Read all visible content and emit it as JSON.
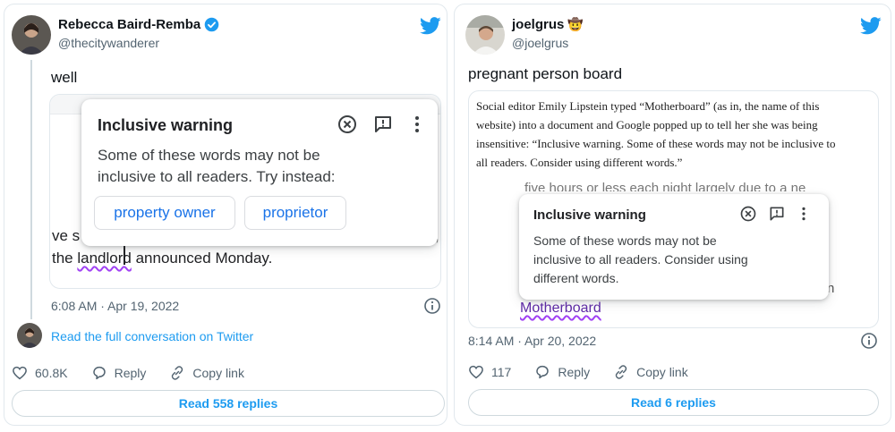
{
  "left_tweet": {
    "author": {
      "name": "Rebecca Baird-Remba",
      "handle": "@thecitywanderer",
      "verified": true
    },
    "text": "well",
    "popup": {
      "title": "Inclusive warning",
      "body_line1": "Some of these words may not be",
      "body_line2": "inclusive to all readers. Try instead:",
      "suggestions": [
        "property owner",
        "proprietor"
      ]
    },
    "doc_fragment": {
      "partial_left": "ve s",
      "sentence_prefix": "the ",
      "flagged_word": "landlord",
      "sentence_suffix": " announced Monday."
    },
    "timestamp": "6:08 AM · Apr 19, 2022",
    "thread_link": "Read the full conversation on Twitter",
    "actions": {
      "likes": "60.8K",
      "reply": "Reply",
      "copy_link": "Copy link"
    },
    "read_replies": "Read 558 replies"
  },
  "right_tweet": {
    "author": {
      "name": "joelgrus",
      "handle": "@joelgrus",
      "emoji": "🤠"
    },
    "text": "pregnant person board",
    "article_paragraph": [
      "Social editor Emily Lipstein typed “Motherboard” (as in, the name of this",
      "website) into a document and Google popped up to tell her she was being",
      "insensitive: “Inclusive warning. Some of these words may not be inclusive to",
      "all readers. Consider using different words.”"
    ],
    "popup": {
      "title": "Inclusive warning",
      "body_lines": [
        "Some of these words may not be",
        "inclusive to all readers. Consider using",
        "different words."
      ]
    },
    "doc_fragment": {
      "partial_top": "five hours or less each night largely due to a ne",
      "partial_right": "n",
      "flagged_word": "Motherboard"
    },
    "timestamp": "8:14 AM · Apr 20, 2022",
    "actions": {
      "likes": "117",
      "reply": "Reply",
      "copy_link": "Copy link"
    },
    "read_replies": "Read 6 replies"
  },
  "colors": {
    "twitter_blue": "#1d9bf0",
    "google_blue": "#1a73e8",
    "flag_purple": "#a142f4",
    "secondary_text": "#536471"
  },
  "icons": [
    "twitter-bird-icon",
    "verified-badge-icon",
    "dismiss-icon",
    "feedback-icon",
    "more-vert-icon",
    "info-icon",
    "heart-icon",
    "reply-icon",
    "link-icon"
  ]
}
